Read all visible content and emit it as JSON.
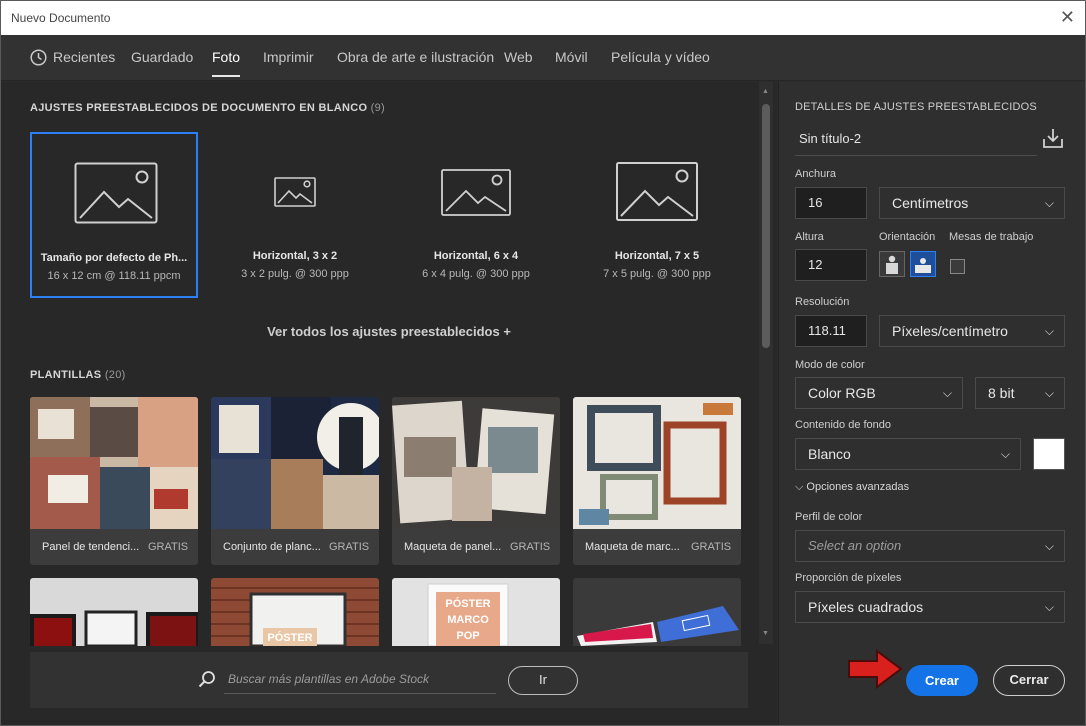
{
  "window": {
    "title": "Nuevo Documento"
  },
  "tabs": [
    {
      "label": "Recientes",
      "icon": "clock-icon"
    },
    {
      "label": "Guardado"
    },
    {
      "label": "Foto",
      "active": true
    },
    {
      "label": "Imprimir"
    },
    {
      "label": "Obra de arte e ilustración"
    },
    {
      "label": "Web"
    },
    {
      "label": "Móvil"
    },
    {
      "label": "Película y vídeo"
    }
  ],
  "presets": {
    "heading": "AJUSTES PREESTABLECIDOS DE DOCUMENTO EN BLANCO",
    "count": "(9)",
    "items": [
      {
        "name": "Tamaño por defecto de Ph...",
        "size": "16 x 12 cm @ 118.11 ppcm"
      },
      {
        "name": "Horizontal, 3 x 2",
        "size": "3 x 2 pulg. @ 300 ppp"
      },
      {
        "name": "Horizontal, 6 x 4",
        "size": "6 x 4 pulg. @ 300 ppp"
      },
      {
        "name": "Horizontal, 7 x 5",
        "size": "7 x 5 pulg. @ 300 ppp"
      }
    ],
    "view_all": "Ver todos los ajustes preestablecidos +"
  },
  "templates": {
    "heading": "PLANTILLAS",
    "count": "(20)",
    "items": [
      {
        "name": "Panel de tendenci...",
        "badge": "GRATIS"
      },
      {
        "name": "Conjunto de planc...",
        "badge": "GRATIS"
      },
      {
        "name": "Maqueta de panel...",
        "badge": "GRATIS"
      },
      {
        "name": "Maqueta de marc...",
        "badge": "GRATIS"
      }
    ],
    "poster_words": [
      "PÓSTER",
      "MARCO",
      "POP"
    ],
    "poster_word_2": "PÓSTER"
  },
  "search": {
    "placeholder": "Buscar más plantillas en Adobe Stock",
    "go": "Ir"
  },
  "details": {
    "heading": "DETALLES DE AJUSTES PREESTABLECIDOS",
    "doc_name": "Sin título-2",
    "width_label": "Anchura",
    "width_value": "16",
    "width_unit": "Centímetros",
    "height_label": "Altura",
    "height_value": "12",
    "orientation_label": "Orientación",
    "artboards_label": "Mesas de trabajo",
    "resolution_label": "Resolución",
    "resolution_value": "118.11",
    "resolution_unit": "Píxeles/centímetro",
    "color_mode_label": "Modo de color",
    "color_mode": "Color RGB",
    "bit_depth": "8 bit",
    "background_label": "Contenido de fondo",
    "background": "Blanco",
    "background_swatch": "#ffffff",
    "advanced": "Opciones avanzadas",
    "color_profile_label": "Perfil de color",
    "color_profile_placeholder": "Select an option",
    "pixel_aspect_label": "Proporción de píxeles",
    "pixel_aspect": "Píxeles cuadrados"
  },
  "actions": {
    "create": "Crear",
    "close": "Cerrar"
  },
  "colors": {
    "accent": "#1473e6",
    "selection": "#2d7ff5",
    "arrow": "#d8201c"
  }
}
